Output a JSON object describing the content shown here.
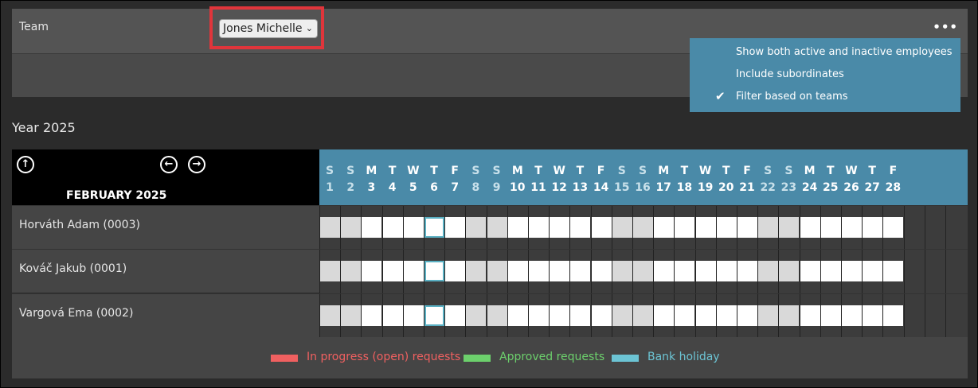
{
  "topbar": {
    "team_label": "Team",
    "selected_team": "Jones Michelle"
  },
  "menu": {
    "items": [
      {
        "label": "Show both active and inactive employees",
        "checked": false
      },
      {
        "label": "Include subordinates",
        "checked": false
      },
      {
        "label": "Filter based on teams",
        "checked": true
      }
    ]
  },
  "calendar": {
    "year_label": "Year 2025",
    "month_label": "FEBRUARY 2025",
    "days": [
      {
        "d": "S",
        "n": "1"
      },
      {
        "d": "S",
        "n": "2"
      },
      {
        "d": "M",
        "n": "3"
      },
      {
        "d": "T",
        "n": "4"
      },
      {
        "d": "W",
        "n": "5"
      },
      {
        "d": "T",
        "n": "6"
      },
      {
        "d": "F",
        "n": "7"
      },
      {
        "d": "S",
        "n": "8"
      },
      {
        "d": "S",
        "n": "9"
      },
      {
        "d": "M",
        "n": "10"
      },
      {
        "d": "T",
        "n": "11"
      },
      {
        "d": "W",
        "n": "12"
      },
      {
        "d": "T",
        "n": "13"
      },
      {
        "d": "F",
        "n": "14"
      },
      {
        "d": "S",
        "n": "15"
      },
      {
        "d": "S",
        "n": "16"
      },
      {
        "d": "M",
        "n": "17"
      },
      {
        "d": "T",
        "n": "18"
      },
      {
        "d": "W",
        "n": "19"
      },
      {
        "d": "T",
        "n": "20"
      },
      {
        "d": "F",
        "n": "21"
      },
      {
        "d": "S",
        "n": "22"
      },
      {
        "d": "S",
        "n": "23"
      },
      {
        "d": "M",
        "n": "24"
      },
      {
        "d": "T",
        "n": "25"
      },
      {
        "d": "W",
        "n": "26"
      },
      {
        "d": "T",
        "n": "27"
      },
      {
        "d": "F",
        "n": "28"
      }
    ],
    "today_day": 6,
    "employees": [
      "Horváth Adam (0003)",
      "Kováč Jakub (0001)",
      "Vargová Ema (0002)"
    ]
  },
  "legend": {
    "items": [
      {
        "label": "In progress (open) requests",
        "color": "#f06060"
      },
      {
        "label": "Approved requests",
        "color": "#6cd06c"
      },
      {
        "label": "Bank holiday",
        "color": "#6cc4d4"
      }
    ]
  }
}
